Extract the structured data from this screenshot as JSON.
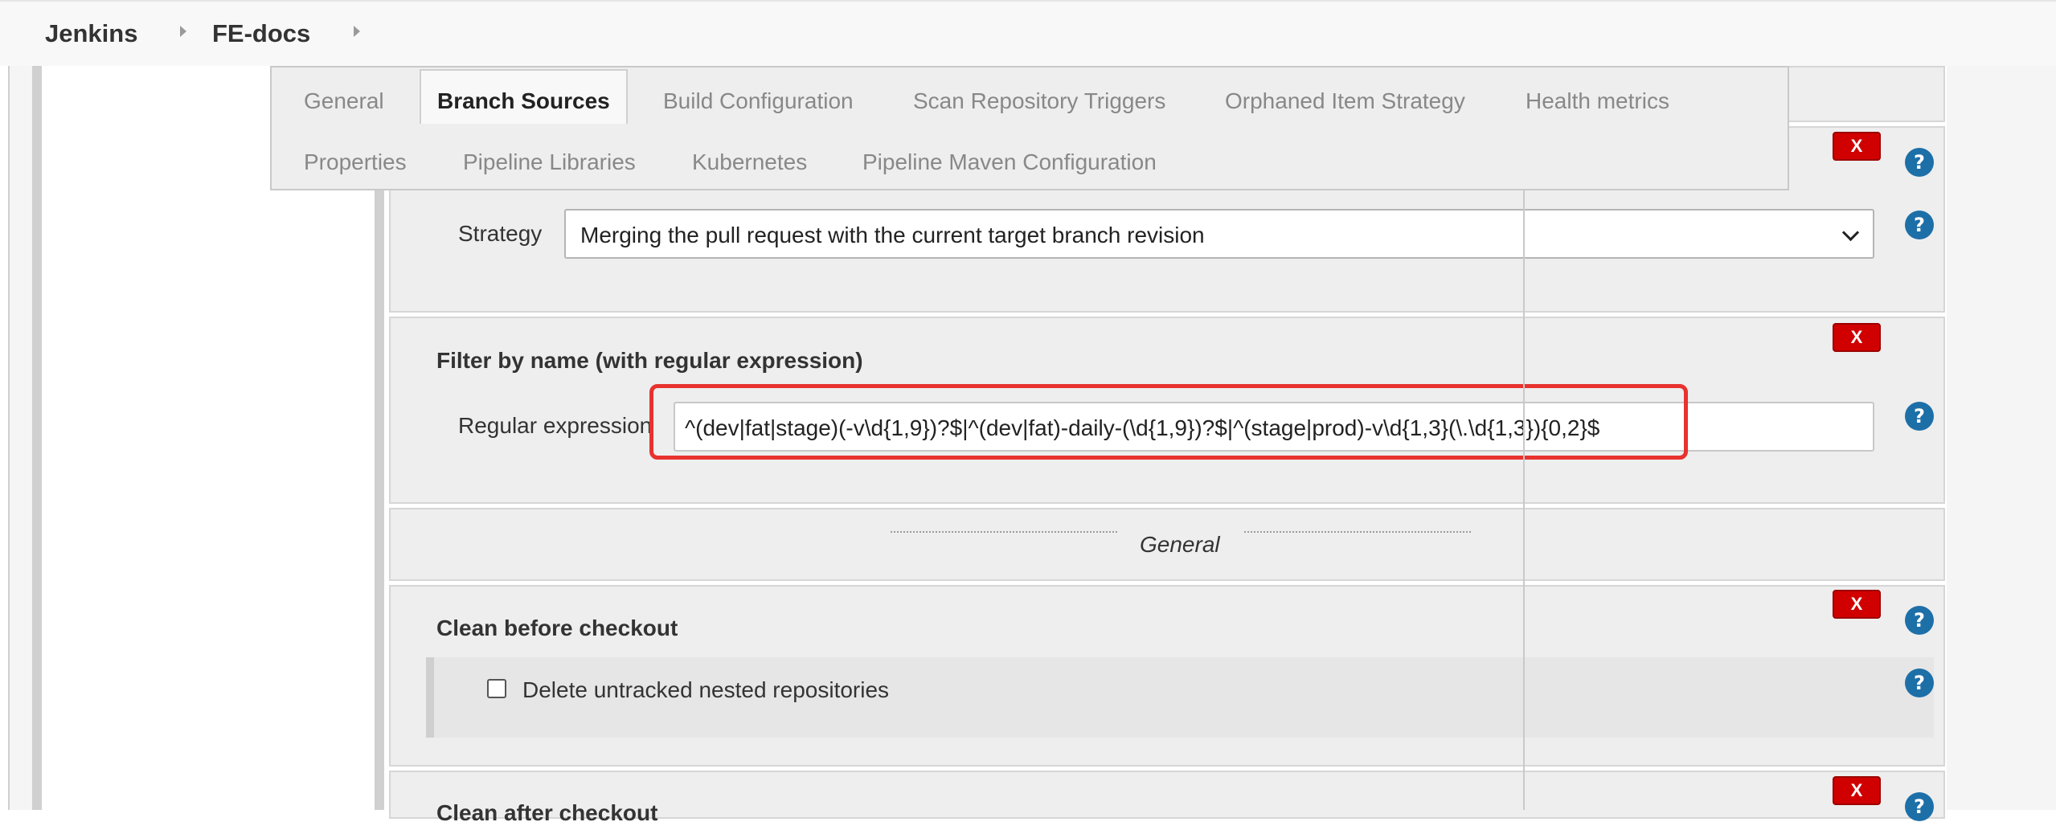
{
  "breadcrumb": {
    "items": [
      "Jenkins",
      "FE-docs"
    ]
  },
  "tabs": {
    "active": "Branch Sources",
    "row1": [
      "General",
      "Branch Sources",
      "Build Configuration",
      "Scan Repository Triggers",
      "Orphaned Item Strategy",
      "Health metrics"
    ],
    "row2": [
      "Properties",
      "Pipeline Libraries",
      "Kubernetes",
      "Pipeline Maven Configuration"
    ]
  },
  "strategy": {
    "label": "Strategy",
    "selected": "Merging the pull request with the current target branch revision"
  },
  "filter": {
    "title": "Filter by name (with regular expression)",
    "regex_label": "Regular expression",
    "regex_value": "^(dev|fat|stage)(-v\\d{1,9})?$|^(dev|fat)-daily-(\\d{1,9})?$|^(stage|prod)-v\\d{1,3}(\\.\\d{1,3}){0,2}$"
  },
  "divider": {
    "text": "General"
  },
  "clean_before": {
    "title": "Clean before checkout",
    "checkbox_label": "Delete untracked nested repositories",
    "checked": false
  },
  "next_section": {
    "title": "Clean after checkout"
  },
  "buttons": {
    "close": "X",
    "help": "?"
  },
  "colors": {
    "close_red": "#d10000",
    "help_blue": "#1d6fa8",
    "highlight_red": "#e8322e"
  },
  "icons": {
    "breadcrumb_separator": "triangle-right",
    "select_arrow": "chevron-down",
    "help": "question-circle"
  }
}
